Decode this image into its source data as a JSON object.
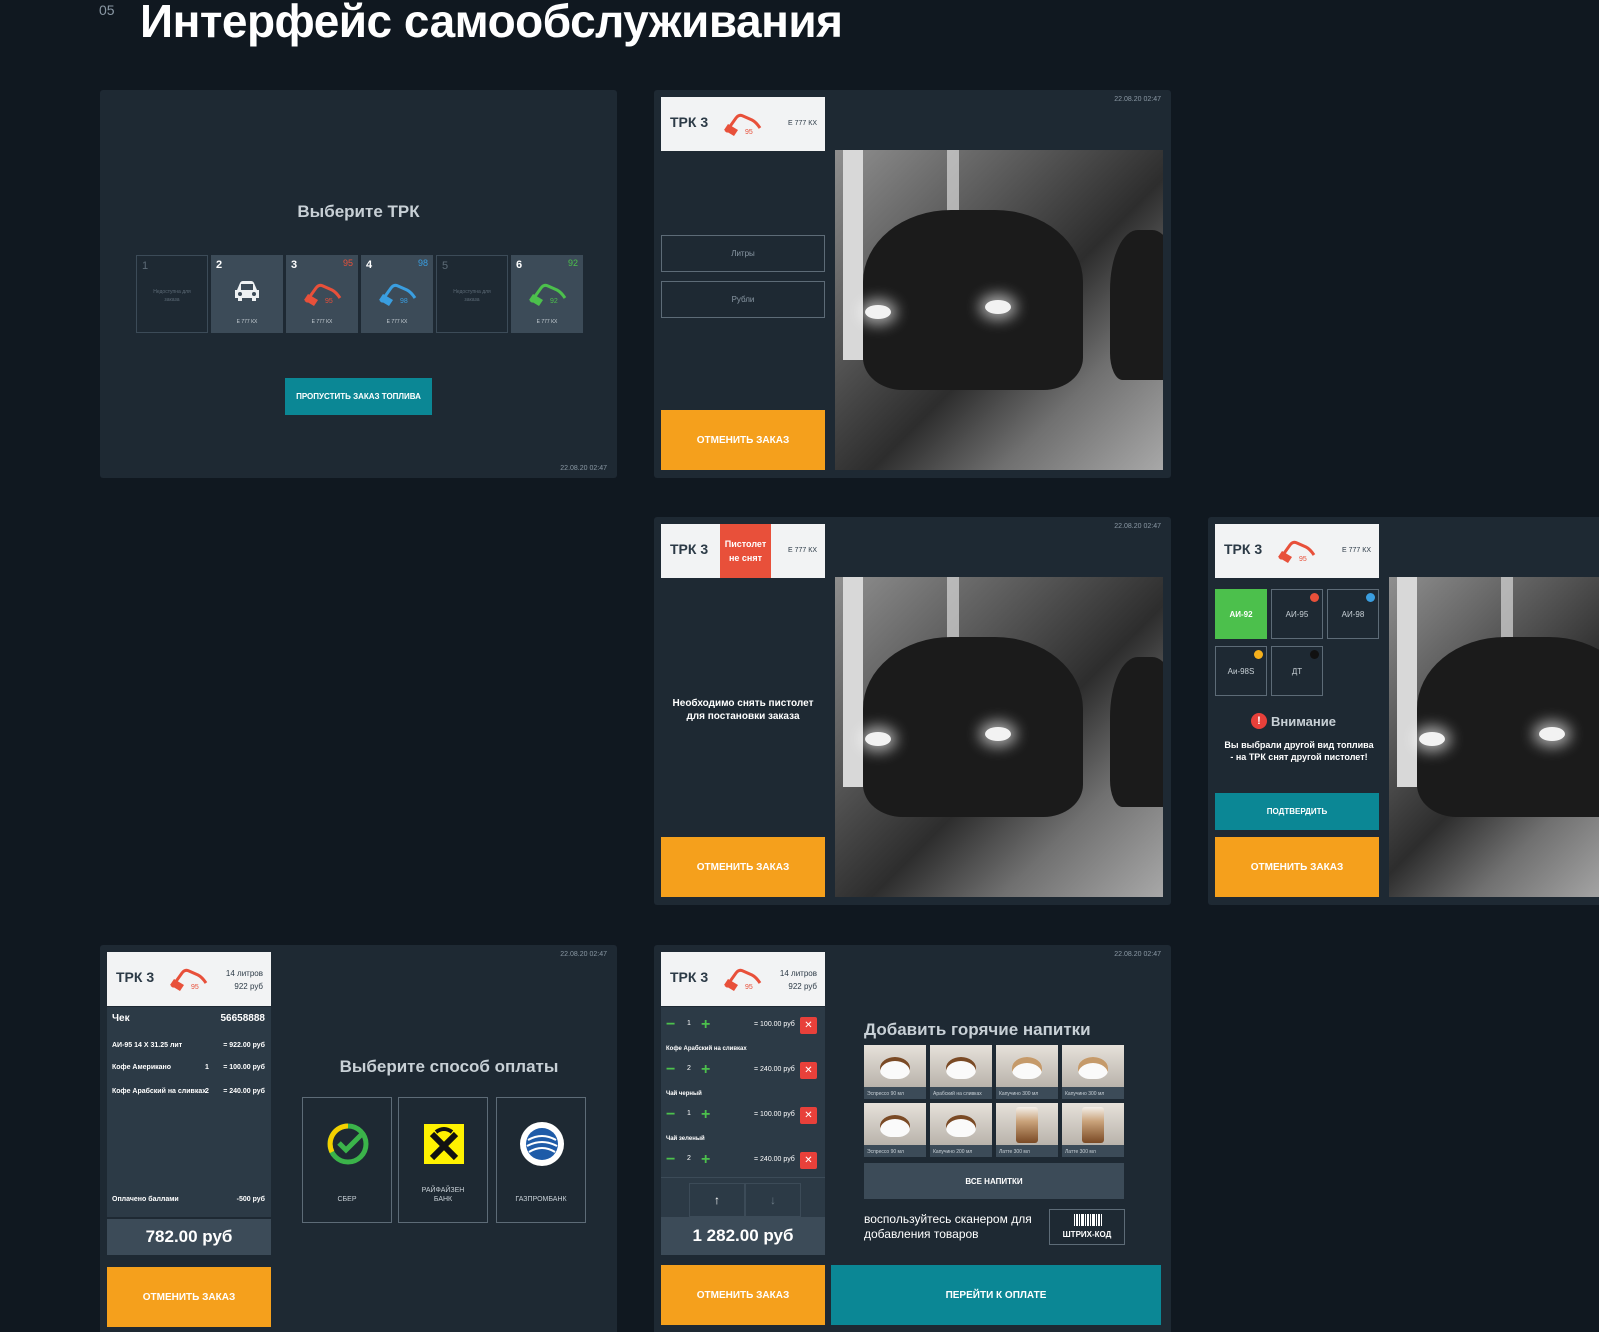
{
  "section_number": "05",
  "page_title": "Интерфейс самообслуживания",
  "timestamp": "22.08.20 02:47",
  "common": {
    "trk_label": "ТРК 3",
    "plate": "Е 777 КХ",
    "cancel_order": "ОТМЕНИТЬ ЗАКАЗ",
    "fuel_95": "95"
  },
  "screen_select": {
    "title": "Выберите ТРК",
    "skip_button": "ПРОПУСТИТЬ ЗАКАЗ ТОПЛИВА",
    "tiles": [
      {
        "num": "1",
        "fuel": "",
        "note": "Недоступна для заказа",
        "plate": ""
      },
      {
        "num": "2",
        "fuel": "",
        "note": "",
        "plate": "Е 777 КХ"
      },
      {
        "num": "3",
        "fuel": "95",
        "note": "",
        "plate": "Е 777 КХ"
      },
      {
        "num": "4",
        "fuel": "98",
        "note": "",
        "plate": "Е 777 КХ"
      },
      {
        "num": "5",
        "fuel": "",
        "note": "Недоступна для заказа",
        "plate": ""
      },
      {
        "num": "6",
        "fuel": "92",
        "note": "",
        "plate": "Е 777 КХ"
      }
    ],
    "fuel_labels": {
      "95": "95",
      "98": "98",
      "92": "92"
    }
  },
  "screen_amount": {
    "liters_button": "Литры",
    "rubles_button": "Рубли"
  },
  "screen_pistol": {
    "badge": "Пистолет не снят",
    "message": "Необходимо снять пистолет для постановки заказа"
  },
  "screen_warning": {
    "fuels": [
      "АИ-92",
      "АИ-95",
      "АИ-98",
      "Аи-98S",
      "ДТ"
    ],
    "warning_title": "Внимание",
    "warning_text": "Вы выбрали другой вид топлива - на ТРК снят другой пистолет!",
    "confirm_button": "ПОДТВЕРДИТЬ"
  },
  "screen_payment": {
    "liters": "14 литров",
    "sum": "922 руб",
    "receipt_label": "Чек",
    "receipt_number": "56658888",
    "lines": [
      {
        "name": "АИ-95 14 X 31.25 лит",
        "qty": "",
        "price": "= 922.00 руб"
      },
      {
        "name": "Кофе Американо",
        "qty": "1",
        "price": "= 100.00 руб"
      },
      {
        "name": "Кофе Арабский на сливках",
        "qty": "2",
        "price": "= 240.00 руб"
      }
    ],
    "points_label": "Оплачено баллами",
    "points_value": "-500 руб",
    "total": "782.00  руб",
    "title": "Выберите способ оплаты",
    "methods": [
      {
        "label": "СБЕР"
      },
      {
        "label": "РАЙФАЙЗЕН БАНК"
      },
      {
        "label": "ГАЗПРОМБАНК"
      }
    ]
  },
  "screen_drinks": {
    "liters": "14 литров",
    "sum": "922 руб",
    "cart": [
      {
        "name": "",
        "qty": "1",
        "price": "= 100.00 руб"
      },
      {
        "name": "Кофе Арабский на сливках",
        "qty": "2",
        "price": "= 240.00 руб"
      },
      {
        "name": "Чай черный",
        "qty": "1",
        "price": "= 100.00 руб"
      },
      {
        "name": "Чай зеленый",
        "qty": "2",
        "price": "= 240.00 руб"
      }
    ],
    "total": "1 282.00  руб",
    "title": "Добавить горячие напитки",
    "drinks": [
      "Эспрессо 90 мл",
      "Арабский на сливках",
      "Капучино 300 мл",
      "Капучино 300 мл",
      "Эспрессо 90 мл",
      "Капучино 200 мл",
      "Латте 300 мл",
      "Латте 300 мл"
    ],
    "all_drinks_button": "ВСЕ НАПИТКИ",
    "scanner_hint": "воспользуйтесь сканером для добавления товаров",
    "barcode_label": "ШТРИХ-КОД",
    "pay_button": "ПЕРЕЙТИ К ОПЛАТЕ"
  },
  "colors": {
    "background": "#101820",
    "panel": "#1e2933",
    "accent_orange": "#f5a01c",
    "accent_teal": "#0b8795",
    "fuel_95": "#e8503a",
    "fuel_98": "#3a9ee0",
    "fuel_92": "#4cc04c",
    "danger": "#e8403a"
  }
}
